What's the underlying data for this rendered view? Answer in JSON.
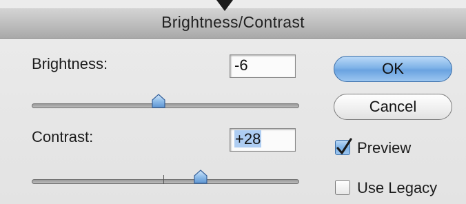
{
  "window": {
    "title": "Brightness/Contrast"
  },
  "brightness": {
    "label": "Brightness:",
    "value": "-6",
    "slider_value": -6,
    "slider_min": -150,
    "slider_max": 150
  },
  "contrast": {
    "label": "Contrast:",
    "value": "+28",
    "slider_value": 28,
    "slider_min": -50,
    "slider_max": 100,
    "value_selected": true
  },
  "buttons": {
    "ok_label": "OK",
    "cancel_label": "Cancel"
  },
  "options": {
    "preview_label": "Preview",
    "preview_checked": true,
    "use_legacy_label": "Use Legacy",
    "use_legacy_checked": false
  },
  "colors": {
    "default_button": "#7fb3e8",
    "selection_highlight": "#aecdf2",
    "titlebar": "#bdbdbd"
  },
  "icons": {
    "thumb": "slider-thumb-icon",
    "check": "checkmark-icon",
    "pointer": "down-arrow-icon"
  }
}
